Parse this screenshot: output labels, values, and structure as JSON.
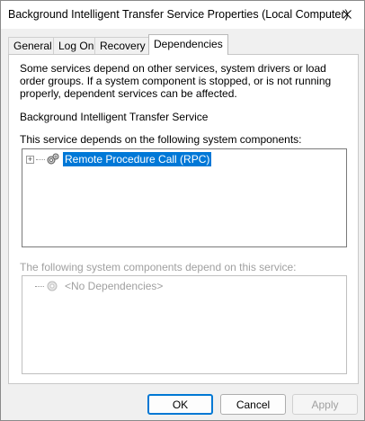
{
  "window": {
    "title": "Background Intelligent Transfer Service Properties (Local Computer)"
  },
  "tabs": [
    {
      "label": "General"
    },
    {
      "label": "Log On"
    },
    {
      "label": "Recovery"
    },
    {
      "label": "Dependencies",
      "active": true
    }
  ],
  "dependencies": {
    "description": "Some services depend on other services, system drivers or load order groups. If a system component is stopped, or is not running properly, dependent services can be affected.",
    "service_name": "Background Intelligent Transfer Service",
    "depends_on_label": "This service depends on the following system components:",
    "depends_on_items": [
      {
        "label": "Remote Procedure Call (RPC)",
        "icon": "gears-icon",
        "expandable": true,
        "selected": true
      }
    ],
    "dependents_label": "The following system components depend on this service:",
    "dependents_items": [
      {
        "label": "<No Dependencies>",
        "icon": "gears-icon",
        "expandable": false,
        "disabled": true
      }
    ]
  },
  "buttons": {
    "ok": "OK",
    "cancel": "Cancel",
    "apply": "Apply"
  },
  "colors": {
    "selection": "#0078d7",
    "default_button_border": "#0078d4",
    "disabled_text": "#a0a0a0"
  }
}
